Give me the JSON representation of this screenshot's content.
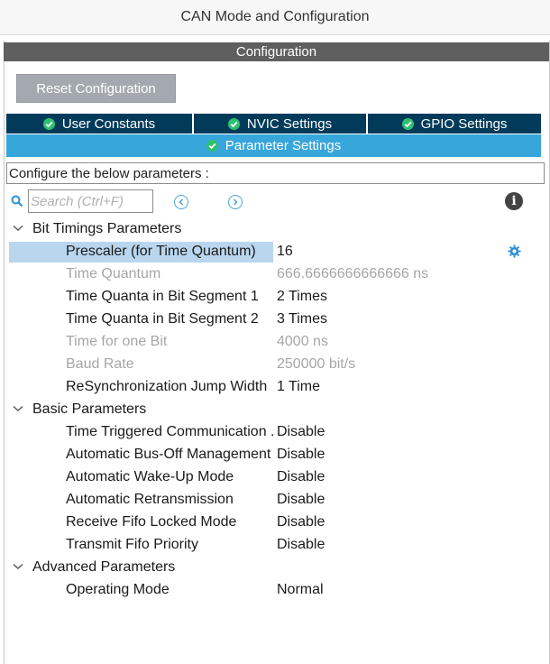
{
  "window": {
    "title": "CAN Mode and Configuration"
  },
  "section": {
    "title": "Configuration"
  },
  "toolbar": {
    "reset_label": "Reset Configuration"
  },
  "tabs": [
    {
      "label": "User Constants"
    },
    {
      "label": "NVIC Settings"
    },
    {
      "label": "GPIO Settings"
    }
  ],
  "active_tab": {
    "label": "Parameter Settings"
  },
  "description": "Configure the below parameters :",
  "search": {
    "placeholder": "Search (Ctrl+F)",
    "value": ""
  },
  "groups": [
    {
      "label": "Bit Timings Parameters",
      "rows": [
        {
          "name": "Prescaler (for Time Quantum)",
          "value": "16",
          "disabled": false,
          "selected": true
        },
        {
          "name": "Time Quantum",
          "value": "666.6666666666666 ns",
          "disabled": true
        },
        {
          "name": "Time Quanta in Bit Segment 1",
          "value": "2 Times",
          "disabled": false
        },
        {
          "name": "Time Quanta in Bit Segment 2",
          "value": "3 Times",
          "disabled": false
        },
        {
          "name": "Time for one Bit",
          "value": "4000 ns",
          "disabled": true
        },
        {
          "name": "Baud Rate",
          "value": "250000 bit/s",
          "disabled": true
        },
        {
          "name": "ReSynchronization Jump Width",
          "value": "1 Time",
          "disabled": false
        }
      ]
    },
    {
      "label": "Basic Parameters",
      "rows": [
        {
          "name": "Time Triggered Communication ..",
          "value": "Disable",
          "disabled": false
        },
        {
          "name": "Automatic Bus-Off Management",
          "value": "Disable",
          "disabled": false
        },
        {
          "name": "Automatic Wake-Up Mode",
          "value": "Disable",
          "disabled": false
        },
        {
          "name": "Automatic Retransmission",
          "value": "Disable",
          "disabled": false
        },
        {
          "name": "Receive Fifo Locked Mode",
          "value": "Disable",
          "disabled": false
        },
        {
          "name": "Transmit Fifo Priority",
          "value": "Disable",
          "disabled": false
        }
      ]
    },
    {
      "label": "Advanced Parameters",
      "rows": [
        {
          "name": "Operating Mode",
          "value": "Normal",
          "disabled": false
        }
      ]
    }
  ],
  "colors": {
    "tab_dark": "#023b5a",
    "tab_active": "#37a6db",
    "section_bar": "#5f5f5f",
    "selection": "#b9d6ee",
    "check_green": "#2fbf71"
  }
}
